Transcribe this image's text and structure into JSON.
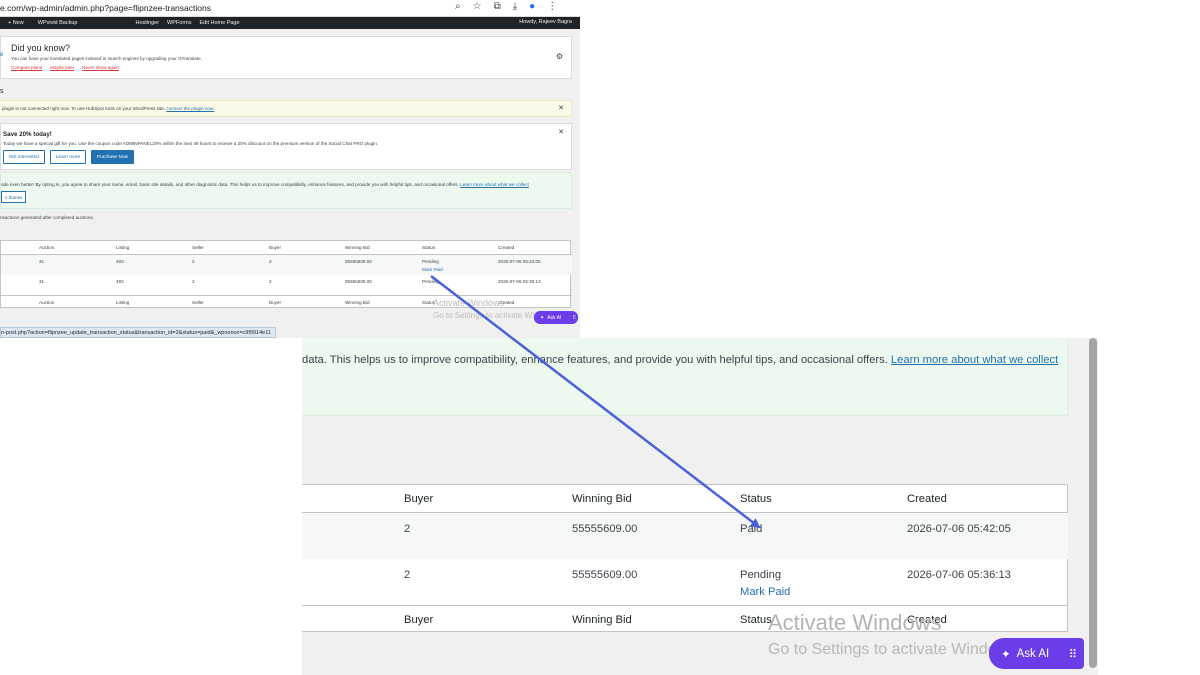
{
  "browser": {
    "url": "e.com/wp-admin/admin.php?page=flipnzee-transactions",
    "icons": [
      "search-icon",
      "star-icon",
      "extensions-icon",
      "download-icon",
      "profile-icon",
      "menu-icon"
    ]
  },
  "admin_bar": {
    "items": [
      "+ New",
      "WPvivid Backup",
      "Hostinger",
      "WPForms",
      "Edit Home Page"
    ],
    "howdy": "Howdy, Rajeev Bagra"
  },
  "did_you_know": {
    "title": "Did you know?",
    "text": "You can have your translated pages indexed in search engines by upgrading your GTranslate.",
    "links": [
      "Compare plans",
      "Maybe later",
      "Never show again"
    ]
  },
  "section_letter": "s",
  "hubspot": {
    "text": "plugin is not connected right now. To use HubSpot tools on your WordPress site, ",
    "link": "connect the plugin now."
  },
  "promo": {
    "title": "Save 20% today!",
    "text": "Today we have a special gift for you. Use the coupon code ADMINPANEL20% within the next 48 hours to receive a 20% discount on the premium version of the Social Chat PRO plugin.",
    "buttons": [
      "Not interested",
      "Learn more",
      "Purchase Now"
    ]
  },
  "optin_small": {
    "text": "ode even better! By opting in, you agree to share your name, email, basic site details, and other diagnostic data. This helps us to improve compatibility, enhance features, and provide you with helpful tips, and occasional offers. ",
    "link": "Learn more about what we collect",
    "button": "o thanks"
  },
  "transactions_desc": "nsactions generated after completed auctions.",
  "small_table": {
    "headers": [
      "Auction",
      "Listing",
      "Seller",
      "Buyer",
      "Winning Bid",
      "Status",
      "Created"
    ],
    "rows": [
      {
        "auction": "31",
        "listing": "493",
        "seller": "2",
        "buyer": "2",
        "bid": "55555609.00",
        "status": "Pending",
        "action": "Mark Paid",
        "created": "2026-07-06 05:42:05"
      },
      {
        "auction": "31",
        "listing": "493",
        "seller": "2",
        "buyer": "2",
        "bid": "55555609.00",
        "status": "Pending",
        "created": "2026-07-06 05:36:13"
      }
    ]
  },
  "status_url": "n-post.php?action=flipnzee_update_transaction_status&transaction_id=2&status=paid&_wpnonce=c9f9914e11",
  "watermark": {
    "line1": "Activate Windows",
    "line2": "Go to Settings to activate Windows."
  },
  "ask_ai": "Ask AI",
  "zoom": {
    "optin_text": "data. This helps us to improve compatibility, enhance features, and provide you with helpful tips, and occasional offers. ",
    "optin_link": "Learn more about what we collect",
    "headers": [
      "Buyer",
      "Winning Bid",
      "Status",
      "Created"
    ],
    "rows": [
      {
        "buyer": "2",
        "bid": "55555609.00",
        "status": "Paid",
        "created": "2026-07-06 05:42:05"
      },
      {
        "buyer": "2",
        "bid": "55555609.00",
        "status": "Pending",
        "action": "Mark Paid",
        "created": "2026-07-06 05:36:13"
      }
    ]
  },
  "colors": {
    "arrow": "#4a62d8",
    "ask_ai_bg": "#6a3de8",
    "link": "#2271b1",
    "admin_bar": "#1d2327"
  }
}
